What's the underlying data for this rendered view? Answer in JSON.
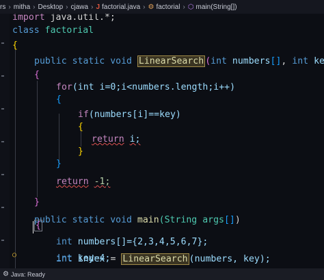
{
  "breadcrumb": {
    "items": [
      "rs",
      "mitha",
      "Desktop",
      "cjawa",
      "factorial.java",
      "factorial",
      "main(String[])"
    ]
  },
  "code": {
    "l1_import": "import",
    "l1_pkg": "java.util.*;",
    "l2_class": "class",
    "l2_name": "factorial",
    "l3": "{",
    "l4_public": "public",
    "l4_static": "static",
    "l4_void": "void",
    "l4_fn": "LinearSearch",
    "l4_open": "(",
    "l4_int1": "int",
    "l4_arr": "numbers",
    "l4_brk": "[]",
    "l4_comma": ",",
    "l4_int2": "int",
    "l4_key": "key",
    "l4_close": ")",
    "l5": "{",
    "l6_for": "for",
    "l6_rest": "(int i=0;i<numbers.length;i++)",
    "l7": "{",
    "l8_if": "if",
    "l8_rest": "(numbers[i]==key)",
    "l9": "{",
    "l10_return": "return",
    "l10_val": "i;",
    "l11": "}",
    "l12": "}",
    "l13_return": "return",
    "l13_val": "-1;",
    "l14": "}",
    "l15_public": "public",
    "l15_static": "static",
    "l15_void": "void",
    "l15_fn": "main",
    "l15_rest1": "(String args",
    "l15_brk": "[]",
    "l15_close": ")",
    "l16": "{",
    "l17_int": "int",
    "l17_rest": "numbers[]={2,3,4,5,6,7};",
    "l18_int": "int",
    "l18_rest": "key=4;",
    "l19_int": "int",
    "l19_var": "index",
    "l19_eq": "=",
    "l19_fn": "LinearSearch",
    "l19_rest": "(numbers, key);"
  },
  "status": {
    "text": "Java: Ready"
  },
  "colors": {
    "background": "#0c0e14",
    "keyword": "#c586c0",
    "type": "#569cd6",
    "function": "#dcdcaa",
    "variable": "#9cdcfe",
    "number": "#b5cea8",
    "brace": "#ffd700"
  },
  "icons": [
    "java-file-icon",
    "class-icon",
    "method-icon",
    "lightbulb-icon",
    "gear-icon"
  ]
}
